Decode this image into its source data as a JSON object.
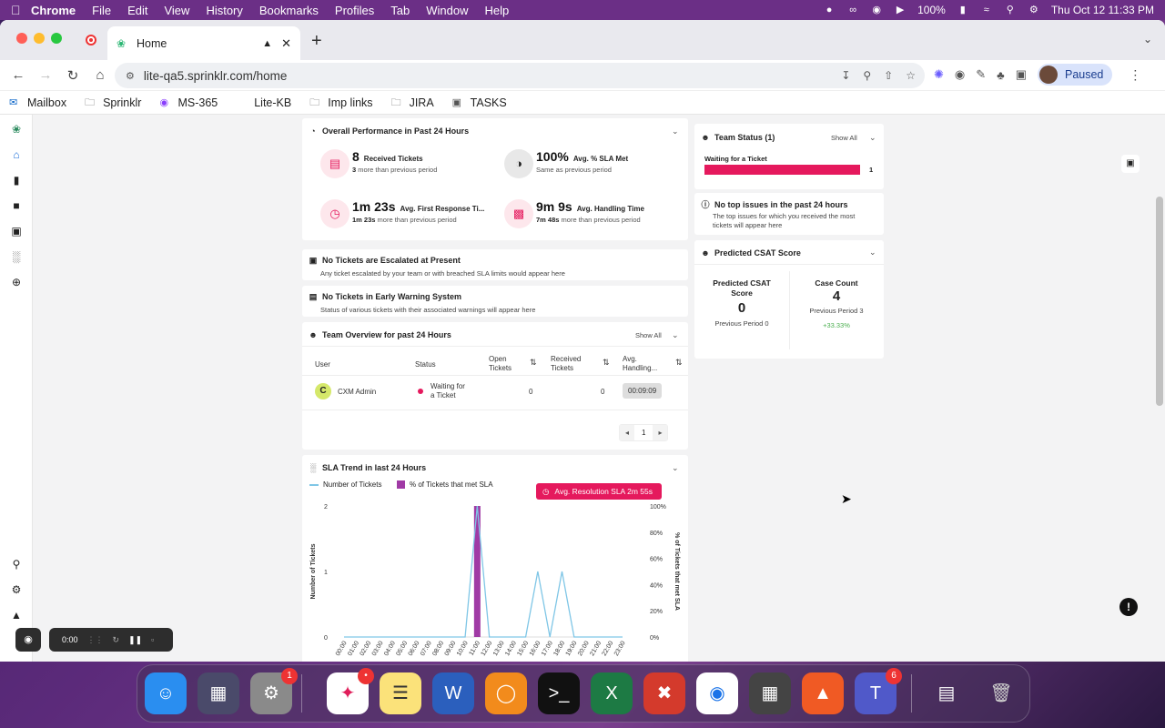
{
  "menubar": {
    "app": "Chrome",
    "items": [
      "File",
      "Edit",
      "View",
      "History",
      "Bookmarks",
      "Profiles",
      "Tab",
      "Window",
      "Help"
    ],
    "battery": "100%",
    "datetime": "Thu Oct 12  11:33 PM"
  },
  "browser": {
    "tab_title": "Home",
    "url": "lite-qa5.sprinklr.com/home",
    "profile_status": "Paused"
  },
  "bookmarks": [
    "Mailbox",
    "Sprinklr",
    "MS-365",
    "Lite-KB",
    "Imp links",
    "JIRA",
    "TASKS"
  ],
  "performance": {
    "title": "Overall Performance in Past 24 Hours",
    "received_value": "8",
    "received_label": "Received Tickets",
    "received_sub_strong": "3",
    "received_sub": "more than previous period",
    "sla_value": "100%",
    "sla_label": "Avg. % SLA Met",
    "sla_sub": "Same as previous period",
    "first_resp_value": "1m 23s",
    "first_resp_label": "Avg. First Response Ti...",
    "first_resp_sub_strong": "1m 23s",
    "first_resp_sub": "more than previous period",
    "handling_value": "9m 9s",
    "handling_label": "Avg. Handling Time",
    "handling_sub_strong": "7m 48s",
    "handling_sub": "more than previous period"
  },
  "escalated": {
    "title": "No Tickets are Escalated at Present",
    "desc": "Any ticket escalated by your team or with breached SLA limits would appear here"
  },
  "early_warning": {
    "title": "No Tickets in Early Warning System",
    "desc": "Status of various tickets with their associated warnings will appear here"
  },
  "team_overview": {
    "title": "Team Overview for past 24 Hours",
    "show_all": "Show All",
    "headers": {
      "user": "User",
      "status": "Status",
      "open1": "Open",
      "open2": "Tickets",
      "recv1": "Received",
      "recv2": "Tickets",
      "avg1": "Avg.",
      "avg2": "Handling..."
    },
    "row": {
      "initial": "C",
      "user": "CXM Admin",
      "status1": "Waiting for",
      "status2": "a Ticket",
      "open": "0",
      "received": "0",
      "handling": "00:09:09"
    },
    "page": "1"
  },
  "sla_trend": {
    "title": "SLA Trend in last 24 Hours",
    "pill": "Avg. Resolution SLA  2m 55s",
    "legend_tickets": "Number of Tickets",
    "legend_sla": "% of Tickets that met SLA"
  },
  "team_status": {
    "title": "Team Status (1)",
    "show_all": "Show All",
    "bar_label": "Waiting for a Ticket",
    "bar_value": "1",
    "fill": 1.0
  },
  "top_issues": {
    "title": "No top issues in the past 24 hours",
    "desc1": "The top issues for which you received the most",
    "desc2": "tickets will appear here"
  },
  "csat": {
    "title": "Predicted CSAT Score",
    "score_label1": "Predicted CSAT",
    "score_label2": "Score",
    "score": "0",
    "score_prev": "Previous Period 0",
    "count_label": "Case Count",
    "count": "4",
    "count_prev": "Previous Period 3",
    "count_change": "+33.33%"
  },
  "recorder": {
    "time": "0:00"
  },
  "dock": {
    "badges": {
      "settings": "1",
      "slack": "•",
      "teams": "6"
    }
  },
  "colors": {
    "accent": "#e5195d",
    "sla_bar": "#a03aa5",
    "line": "#7fc6e6",
    "green": "#4caf50"
  },
  "chart_data": {
    "type": "line",
    "title": "SLA Trend in last 24 Hours",
    "x": [
      "00:00",
      "01:00",
      "02:00",
      "03:00",
      "04:00",
      "05:00",
      "06:00",
      "07:00",
      "08:00",
      "09:00",
      "10:00",
      "11:00",
      "12:00",
      "13:00",
      "14:00",
      "15:00",
      "16:00",
      "17:00",
      "18:00",
      "19:00",
      "20:00",
      "21:00",
      "22:00",
      "23:00"
    ],
    "series": [
      {
        "name": "Number of Tickets",
        "type": "line",
        "values": [
          0,
          0,
          0,
          0,
          0,
          0,
          0,
          0,
          0,
          0,
          0,
          2,
          0,
          0,
          0,
          0,
          1,
          0,
          1,
          0,
          0,
          0,
          0,
          0
        ]
      },
      {
        "name": "% of Tickets that met SLA",
        "type": "bar",
        "values": [
          0,
          0,
          0,
          0,
          0,
          0,
          0,
          0,
          0,
          0,
          0,
          100,
          0,
          0,
          0,
          0,
          0,
          0,
          0,
          0,
          0,
          0,
          0,
          0
        ]
      }
    ],
    "ylabel": "Number of Tickets",
    "y2label": "% of Tickets that met SLA",
    "yticks": [
      "0",
      "1",
      "2"
    ],
    "y2ticks": [
      "0%",
      "20%",
      "40%",
      "60%",
      "80%",
      "100%"
    ],
    "ylim": [
      0,
      2
    ],
    "y2lim": [
      0,
      100
    ]
  }
}
